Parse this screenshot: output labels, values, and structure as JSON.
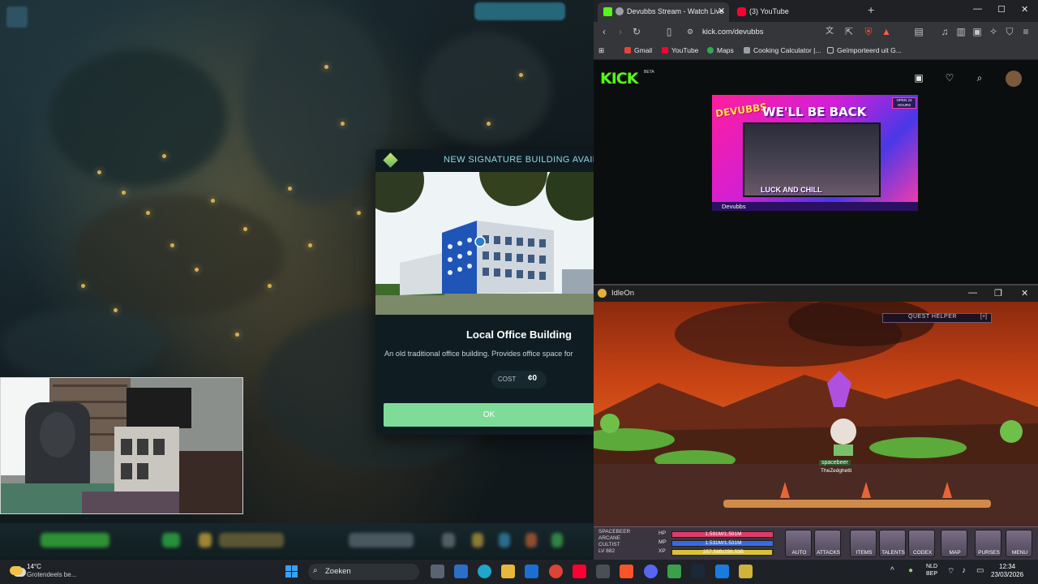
{
  "game": {
    "modal": {
      "header": "NEW SIGNATURE BUILDING AVAILABLE",
      "building_name": "Local Office Building",
      "description": "An old traditional office building. Provides office space for",
      "cost_label": "COST",
      "cost_value": "¢0",
      "ok_label": "OK"
    }
  },
  "browser": {
    "tabs": [
      {
        "label": "Devubbs Stream - Watch Live",
        "favicon_color": "#53fc18"
      },
      {
        "label": "(3) YouTube",
        "favicon_color": "#ff0033"
      }
    ],
    "url": "kick.com/devubbs",
    "bookmarks": [
      "Gmail",
      "YouTube",
      "Maps",
      "Cooking Calculator |...",
      "Geïmporteerd uit G..."
    ],
    "kick": {
      "logo": "KICK",
      "beta": "BETA",
      "thumbnail": {
        "brand": "DEVUBBS",
        "title": "WE'LL BE BACK",
        "caption": "LUCK AND CHILL",
        "channel": "Devubbs",
        "badge": "OPEN 24 HOURS"
      }
    }
  },
  "idleon": {
    "window_title": "IdleOn",
    "quest_helper": "QUEST HELPER",
    "quest_helper_toggle": "[+]",
    "character": {
      "line1": "SPACEBEER",
      "line2": "ARCANE",
      "line3": "CULTIST",
      "level": "LV 882",
      "player_name": "spacebeer",
      "player_title": "TheZedghetti"
    },
    "stats": {
      "hp_label": "HP",
      "mp_label": "MP",
      "xp_label": "XP",
      "hp_value": "1.591M/1.591M",
      "mp_value": "1.531M/1.531M",
      "xp_value": "257.58B/256.59B",
      "hp_fill": 1.0,
      "mp_fill": 1.0,
      "xp_fill": 0.99
    },
    "hotbar": [
      "AUTO",
      "ATTACKS",
      "ITEMS",
      "TALENTS",
      "CODEX",
      "MAP",
      "PURSES",
      "MENU"
    ]
  },
  "taskbar": {
    "weather_temp": "14°C",
    "weather_desc": "Grotendeels be...",
    "search_placeholder": "Zoeken",
    "lang_line1": "NLD",
    "lang_line2": "BEP",
    "time": "12:34",
    "date": "23/03/2026"
  }
}
